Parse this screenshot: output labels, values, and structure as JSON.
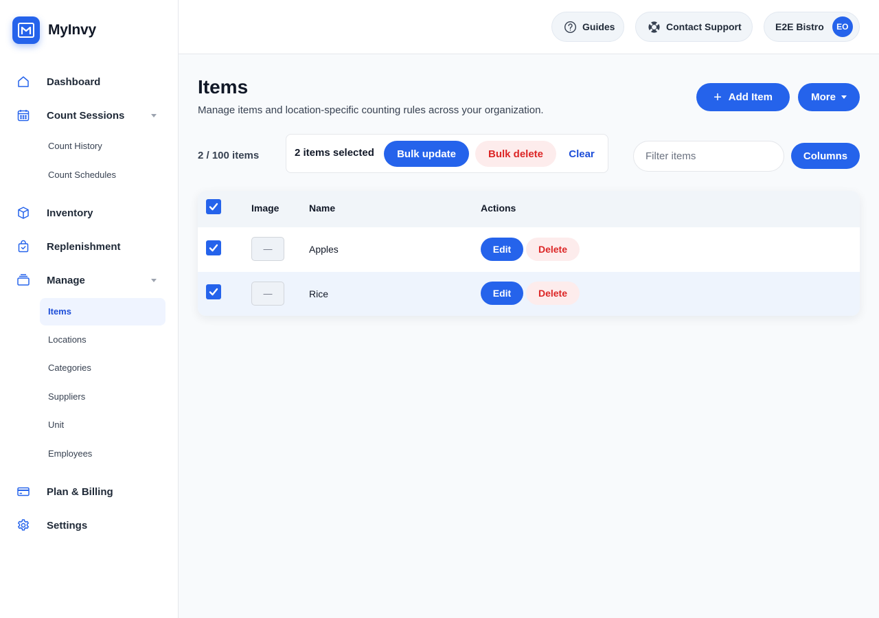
{
  "brand": {
    "name": "MyInvy",
    "logo_icon": "logo-icon",
    "accent": "#2563eb"
  },
  "sidebar": {
    "dashboard": "Dashboard",
    "count_sessions": "Count Sessions",
    "count_history": "Count History",
    "count_schedules": "Count Schedules",
    "inventory": "Inventory",
    "replenishment": "Replenishment",
    "manage": "Manage",
    "items": "Items",
    "locations": "Locations",
    "categories": "Categories",
    "suppliers": "Suppliers",
    "unit": "Unit",
    "employees": "Employees",
    "plan_billing": "Plan & Billing",
    "settings": "Settings"
  },
  "topbar": {
    "guides": "Guides",
    "contact_support": "Contact Support",
    "org_name": "E2E Bistro",
    "avatar_initials": "EO"
  },
  "page": {
    "title": "Items",
    "subtitle": "Manage items and location-specific counting rules across your organization.",
    "add_item": "Add Item",
    "more": "More",
    "count": "2 / 100 items"
  },
  "bulk": {
    "selected_count": "2",
    "selected_text": " items selected",
    "bulk_update": "Bulk update",
    "bulk_delete": "Bulk delete",
    "clear": "Clear"
  },
  "filter": {
    "placeholder": "Filter items",
    "columns": "Columns"
  },
  "table": {
    "headers": {
      "image": "Image",
      "name": "Name",
      "actions": "Actions"
    },
    "rows": [
      {
        "image": "—",
        "name": "Apples",
        "edit": "Edit",
        "delete": "Delete",
        "checked": true
      },
      {
        "image": "—",
        "name": "Rice",
        "edit": "Edit",
        "delete": "Delete",
        "checked": true
      }
    ]
  }
}
